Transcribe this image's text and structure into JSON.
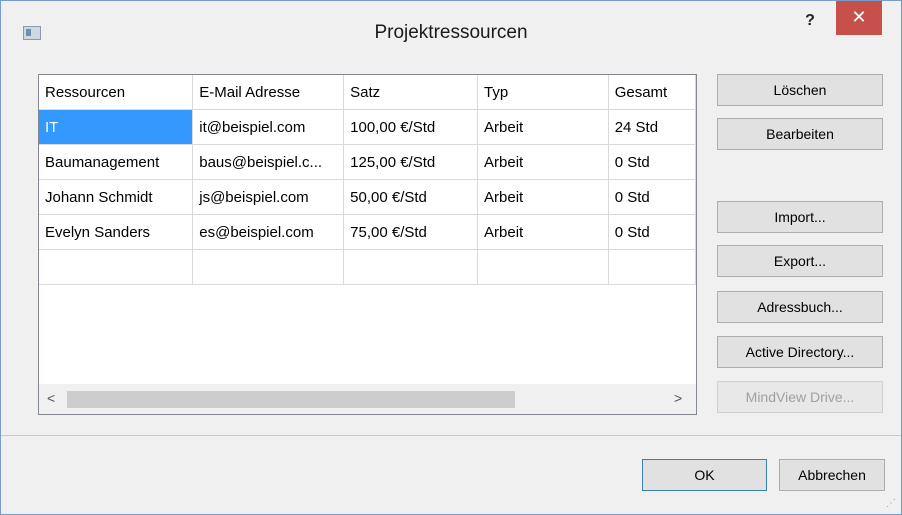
{
  "window": {
    "title": "Projektressourcen",
    "help_label": "?",
    "close_label": "✕"
  },
  "table": {
    "columns": [
      "Ressourcen",
      "E-Mail Adresse",
      "Satz",
      "Typ",
      "Gesamt"
    ],
    "rows": [
      [
        "IT",
        "it@beispiel.com",
        "100,00 €/Std",
        "Arbeit",
        "24 Std"
      ],
      [
        "Baumanagement",
        "baus@beispiel.c...",
        "125,00 €/Std",
        "Arbeit",
        "0 Std"
      ],
      [
        "Johann Schmidt",
        "js@beispiel.com",
        "50,00 €/Std",
        "Arbeit",
        "0 Std"
      ],
      [
        "Evelyn Sanders",
        "es@beispiel.com",
        "75,00 €/Std",
        "Arbeit",
        "0 Std"
      ],
      [
        "",
        "",
        "",
        "",
        ""
      ]
    ],
    "selected_row": 0
  },
  "scrollbar": {
    "left_arrow": "<",
    "right_arrow": ">"
  },
  "buttons": {
    "delete": "Löschen",
    "edit": "Bearbeiten",
    "import": "Import...",
    "export": "Export...",
    "address_book": "Adressbuch...",
    "active_directory": "Active Directory...",
    "mindview_drive": "MindView Drive...",
    "ok": "OK",
    "cancel": "Abbrechen"
  },
  "colors": {
    "selection": "#3399ff",
    "close": "#c7504b"
  }
}
